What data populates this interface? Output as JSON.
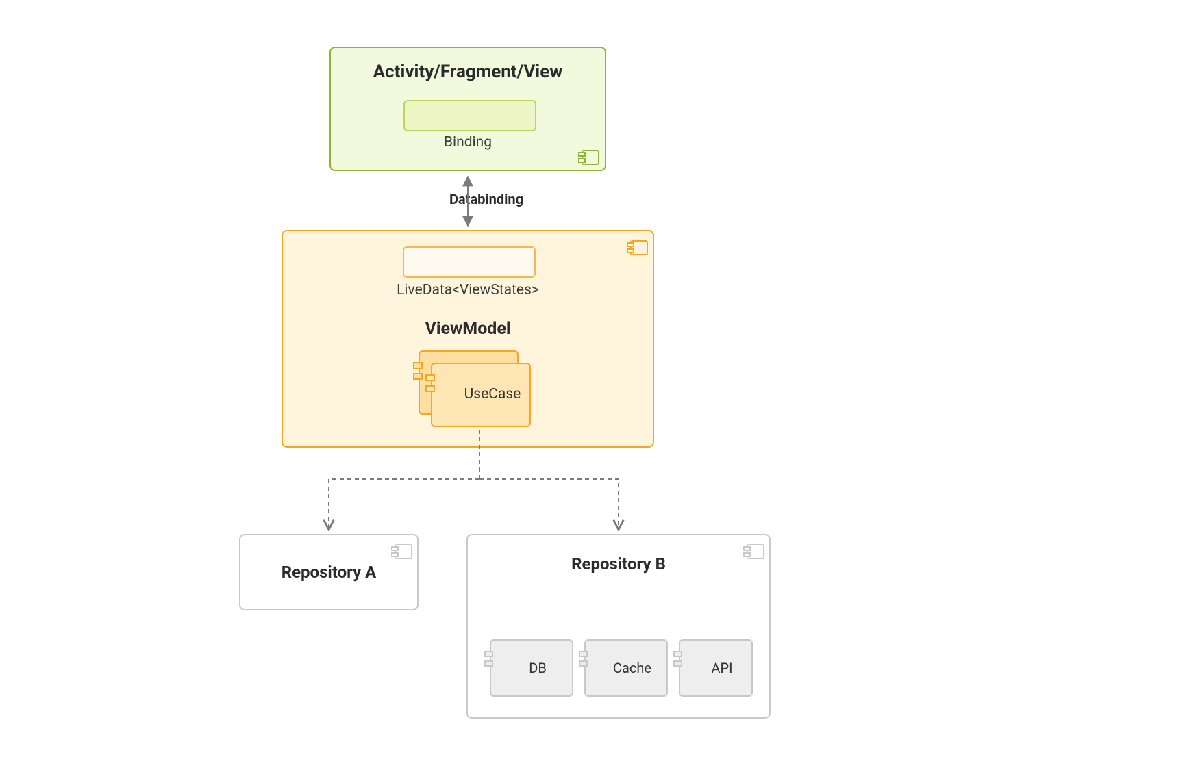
{
  "diagram": {
    "activity": {
      "title": "Activity/Fragment/View",
      "binding_label": "Binding"
    },
    "connector_databinding": "Databinding",
    "viewmodel": {
      "livedata_label": "LiveData<ViewStates>",
      "title": "ViewModel",
      "usecase_label": "UseCase"
    },
    "repo_a": {
      "title": "Repository A"
    },
    "repo_b": {
      "title": "Repository B",
      "children": {
        "db": "DB",
        "cache": "Cache",
        "api": "API"
      }
    },
    "colors": {
      "green_border": "#8fb339",
      "green_fill": "#f3f9dd",
      "orange_border": "#f5a623",
      "orange_fill": "#fff4dc",
      "grey_border": "#c9c9c9",
      "grey_fill": "#eeeeee"
    }
  }
}
